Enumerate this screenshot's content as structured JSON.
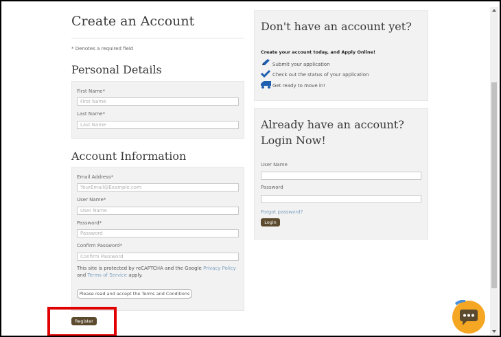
{
  "create": {
    "title": "Create an Account",
    "required_note": "* Denotes a required field"
  },
  "personal": {
    "heading": "Personal Details",
    "first_name_label": "First Name*",
    "first_name_placeholder": "First Name",
    "last_name_label": "Last Name*",
    "last_name_placeholder": "Last Name"
  },
  "account": {
    "heading": "Account Information",
    "email_label": "Email Address*",
    "email_placeholder": "YourEmail@Example.com",
    "username_label": "User Name*",
    "username_placeholder": "User Name",
    "password_label": "Password*",
    "password_placeholder": "Password",
    "confirm_label": "Confirm Password*",
    "confirm_placeholder": "Confirm Password",
    "recaptcha_prefix": "This site is protected by reCAPTCHA and the Google ",
    "privacy_link": "Privacy Policy",
    "recaptcha_and": "and ",
    "terms_link": "Terms of Service",
    "recaptcha_suffix": " apply.",
    "terms_button": "Please read and accept the Terms and Conditions",
    "register_button": "Register"
  },
  "promo": {
    "heading": "Don't have an account yet?",
    "subheading": "Create your account today, and Apply Online!",
    "features": [
      {
        "icon": "pencil-icon",
        "text": "Submit your application"
      },
      {
        "icon": "checkmark-icon",
        "text": "Check out the status of your application"
      },
      {
        "icon": "truck-icon",
        "text": "Get ready to move in!"
      }
    ]
  },
  "login": {
    "heading": "Already have an account? Login Now!",
    "username_label": "User Name",
    "password_label": "Password",
    "forgot_link": "Forgot password?",
    "login_button": "Login"
  },
  "colors": {
    "accent_brown": "#5b4a2e",
    "panel_bg": "#f2f2f2",
    "link_blue": "#7a9fbf",
    "highlight_red": "#e00000",
    "chat_orange": "#f5a623"
  }
}
